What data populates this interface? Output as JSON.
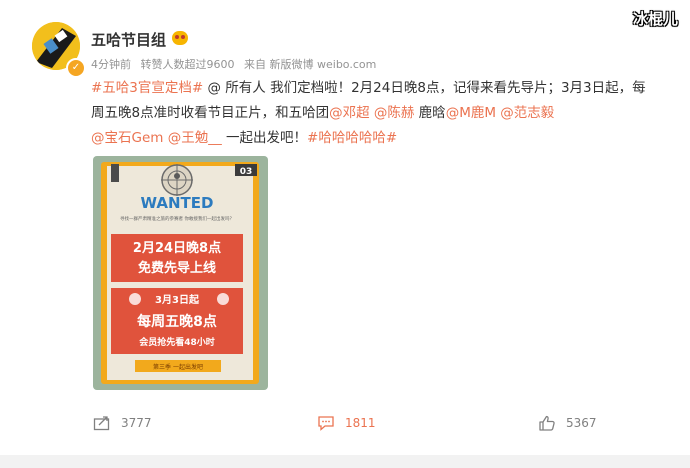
{
  "watermark": "冰棍儿",
  "post": {
    "author": "五哈节目组",
    "meta": {
      "time": "4分钟前",
      "reposts": "转赞人数超过9600",
      "source": "来自 新版微博 weibo.com"
    },
    "content": {
      "tag1": "#五哈3官宣定档#",
      "text1": " @ 所有人 我们定档啦！2月24日晚8点，记得来看先导片；3月3日起，每周五晚8点准时收看节目正片，和五哈团",
      "m1": "@邓超",
      "s1": " ",
      "m2": "@陈赫",
      "s2": " 鹿晗",
      "m3": "@M鹿M",
      "s3": " ",
      "m4": "@范志毅",
      "s4": " ",
      "m5": "@宝石Gem",
      "s5": " ",
      "m6": "@王勉__",
      "text2": " 一起出发吧！",
      "tag2": "#哈哈哈哈哈#"
    },
    "poster": {
      "wanted": "WANTED",
      "subtitle": "寻找一群严肃精准之旅的参赛者 你敢接我们一起出发吗？",
      "line1": "2月24日晚8点",
      "line2": "免费先导上线",
      "line3": "3月3日起",
      "line4": "每周五晚8点",
      "line5": "会员抢先看48小时",
      "footer": "第三季 一起出发吧"
    },
    "actions": {
      "repost_count": "3777",
      "comment_count": "1811",
      "like_count": "5367"
    }
  },
  "colors": {
    "accent": "#eb7350",
    "poster_red": "#e0533c",
    "poster_border": "#f2a91c"
  }
}
